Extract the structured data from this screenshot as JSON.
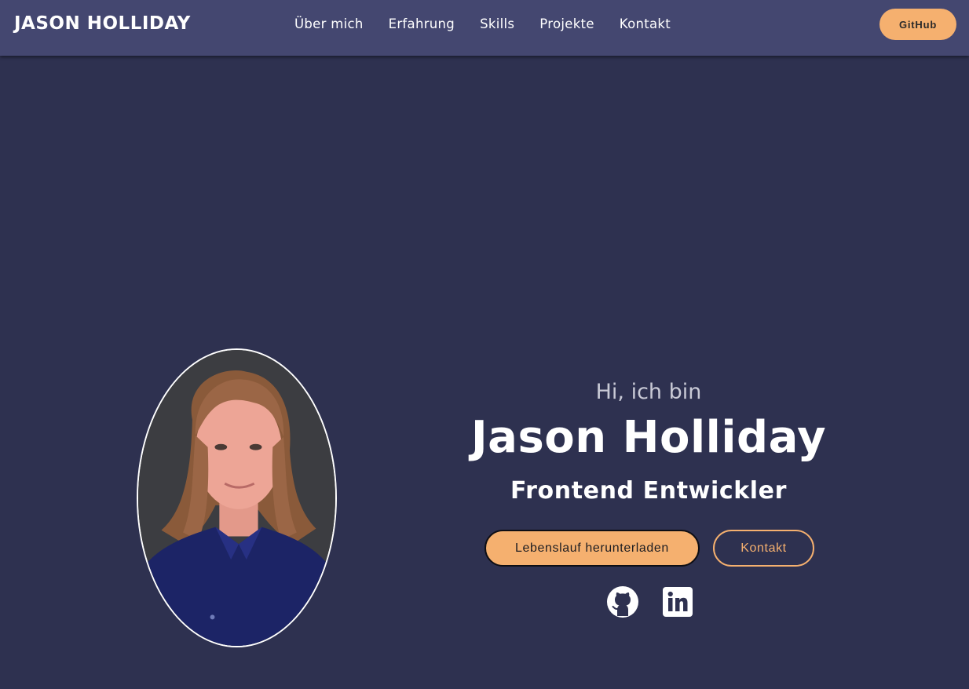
{
  "navbar": {
    "brand": "JASON HOLLIDAY",
    "links": [
      "Über mich",
      "Erfahrung",
      "Skills",
      "Projekte",
      "Kontakt"
    ],
    "github_label": "GitHub"
  },
  "hero": {
    "greeting": "Hi, ich bin",
    "name": "Jason Holliday",
    "role": "Frontend Entwickler",
    "download_label": "Lebenslauf herunterladen",
    "contact_label": "Kontakt",
    "socials": [
      "github-icon",
      "linkedin-icon"
    ]
  },
  "colors": {
    "background": "#2e3150",
    "navbar": "#444770",
    "accent": "#f5b06f",
    "text": "#ffffff",
    "muted_text": "#c9cad6"
  }
}
